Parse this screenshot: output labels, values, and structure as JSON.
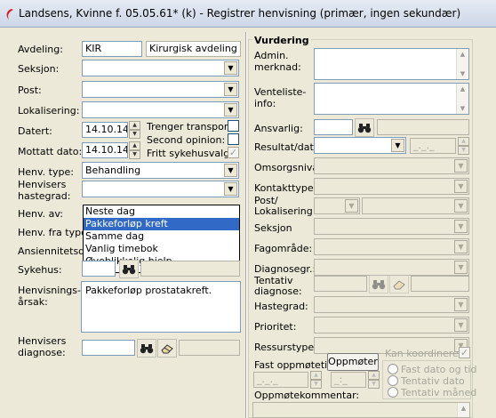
{
  "window": {
    "title": "Landsens, Kvinne f. 05.05.61* (k) - Registrer henvisning (primær, ingen sekundær)"
  },
  "left": {
    "avdeling": {
      "label": "Avdeling:",
      "code": "KIR",
      "name": "Kirurgisk avdeling"
    },
    "seksjon": {
      "label": "Seksjon:",
      "value": ""
    },
    "post": {
      "label": "Post:",
      "value": ""
    },
    "lokalisering": {
      "label": "Lokalisering:",
      "value": ""
    },
    "datert": {
      "label": "Datert:",
      "value": "14.10.14"
    },
    "mottatt": {
      "label": "Mottatt dato:",
      "value": "14.10.14"
    },
    "checks": {
      "transport": {
        "label": "Trenger transport:",
        "checked": false
      },
      "second": {
        "label": "Second opinion:",
        "checked": false
      },
      "fritt": {
        "label": "Fritt sykehusvalg",
        "checked": true
      }
    },
    "henv_type": {
      "label": "Henv. type:",
      "value": "Behandling"
    },
    "hastegrad": {
      "label1": "Henvisers",
      "label2": "hastegrad:",
      "value": ""
    },
    "henv_av": {
      "label": "Henv. av:"
    },
    "henv_fra_type": {
      "label": "Henv. fra type:"
    },
    "ansiennitet": {
      "label": "Ansiennitetsdat"
    },
    "sykehus": {
      "label": "Sykehus:"
    },
    "henvisningsarsak": {
      "label1": "Henvisnings-",
      "label2": "årsak:",
      "value": "Pakkeforløp prostatakreft."
    },
    "diagnose": {
      "label1": "Henvisers",
      "label2": "diagnose:",
      "value": ""
    },
    "dropdown_options": [
      "Neste dag",
      "Pakkeforløp kreft",
      "Samme dag",
      "Vanlig timebok",
      "Øyeblikkelig hjelp"
    ],
    "dropdown_selected_index": 1
  },
  "right": {
    "heading": "Vurdering",
    "admin": {
      "label1": "Admin.",
      "label2": "merknad:"
    },
    "venteliste": {
      "label1": "Venteliste-",
      "label2": "info:"
    },
    "ansvarlig": {
      "label": "Ansvarlig:"
    },
    "resultat": {
      "label": "Resultat/dato:",
      "date_placeholder": "_._._"
    },
    "omsorgsniva": {
      "label": "Omsorgsnivå:"
    },
    "kontakttype": {
      "label": "Kontakttype:"
    },
    "postlok": {
      "label1": "Post/",
      "label2": "Lokalisering:"
    },
    "seksjon": {
      "label": "Seksjon"
    },
    "fagomrade": {
      "label": "Fagområde:"
    },
    "diagnosegr": {
      "label": "Diagnosegr.:"
    },
    "tentativ": {
      "label1": "Tentativ",
      "label2": "diagnose:"
    },
    "hastegrad": {
      "label": "Hastegrad:"
    },
    "prioritet": {
      "label": "Prioritet:"
    },
    "ressurstype": {
      "label": "Ressurstype:"
    },
    "fast_oppmotetid": {
      "label": "Fast oppmøtetid:",
      "button": "Oppmøter",
      "time1": "_._._",
      "time2": "_:_"
    },
    "kan_koordineres": {
      "label": "Kan koordineres:",
      "checked": true
    },
    "radios": [
      "Fast dato og tid",
      "Tentativ dato",
      "Tentativ måned"
    ],
    "oppmotekommentar": {
      "label": "Oppmøtekommentar:"
    }
  },
  "icons": {
    "app": "red-swoosh-icon",
    "search": "binoculars-icon",
    "eraser": "eraser-icon"
  }
}
